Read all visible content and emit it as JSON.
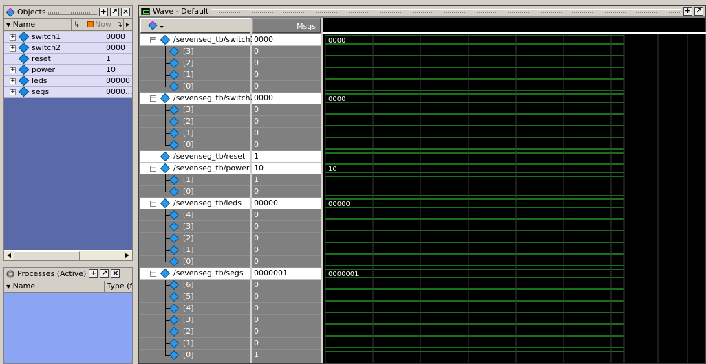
{
  "objects_pane": {
    "title": "Objects",
    "header": {
      "name": "Name",
      "now": "Now"
    },
    "items": [
      {
        "name": "switch1",
        "value": "0000",
        "expandable": true
      },
      {
        "name": "switch2",
        "value": "0000",
        "expandable": true
      },
      {
        "name": "reset",
        "value": "1",
        "expandable": false
      },
      {
        "name": "power",
        "value": "10",
        "expandable": true
      },
      {
        "name": "leds",
        "value": "00000",
        "expandable": true
      },
      {
        "name": "segs",
        "value": "0000...",
        "expandable": true
      }
    ]
  },
  "processes_pane": {
    "title": "Processes (Active)",
    "header": {
      "name": "Name",
      "type": "Type (f"
    }
  },
  "wave_window": {
    "title": "Wave - Default",
    "msgs_label": "Msgs",
    "signals": [
      {
        "name": "/sevenseg_tb/switch1",
        "value": "0000",
        "bus_value": "0000",
        "expanded": true,
        "bits": [
          {
            "label": "[3]",
            "value": "0"
          },
          {
            "label": "[2]",
            "value": "0"
          },
          {
            "label": "[1]",
            "value": "0"
          },
          {
            "label": "[0]",
            "value": "0"
          }
        ]
      },
      {
        "name": "/sevenseg_tb/switch2",
        "value": "0000",
        "bus_value": "0000",
        "expanded": true,
        "bits": [
          {
            "label": "[3]",
            "value": "0"
          },
          {
            "label": "[2]",
            "value": "0"
          },
          {
            "label": "[1]",
            "value": "0"
          },
          {
            "label": "[0]",
            "value": "0"
          }
        ]
      },
      {
        "name": "/sevenseg_tb/reset",
        "value": "1",
        "bus_value": "",
        "expanded": false,
        "bits": []
      },
      {
        "name": "/sevenseg_tb/power",
        "value": "10",
        "bus_value": "10",
        "expanded": true,
        "bits": [
          {
            "label": "[1]",
            "value": "1"
          },
          {
            "label": "[0]",
            "value": "0"
          }
        ]
      },
      {
        "name": "/sevenseg_tb/leds",
        "value": "00000",
        "bus_value": "00000",
        "expanded": true,
        "bits": [
          {
            "label": "[4]",
            "value": "0"
          },
          {
            "label": "[3]",
            "value": "0"
          },
          {
            "label": "[2]",
            "value": "0"
          },
          {
            "label": "[1]",
            "value": "0"
          },
          {
            "label": "[0]",
            "value": "0"
          }
        ]
      },
      {
        "name": "/sevenseg_tb/segs",
        "value": "0000001",
        "bus_value": "0000001",
        "expanded": true,
        "bits": [
          {
            "label": "[6]",
            "value": "0"
          },
          {
            "label": "[5]",
            "value": "0"
          },
          {
            "label": "[4]",
            "value": "0"
          },
          {
            "label": "[3]",
            "value": "0"
          },
          {
            "label": "[2]",
            "value": "0"
          },
          {
            "label": "[1]",
            "value": "0"
          },
          {
            "label": "[0]",
            "value": "1"
          }
        ]
      }
    ]
  },
  "colors": {
    "wave_green": "#33e033",
    "wave_bg": "#000000",
    "object_row": "#dcdcf4",
    "process_bg": "#8ca4f4"
  }
}
